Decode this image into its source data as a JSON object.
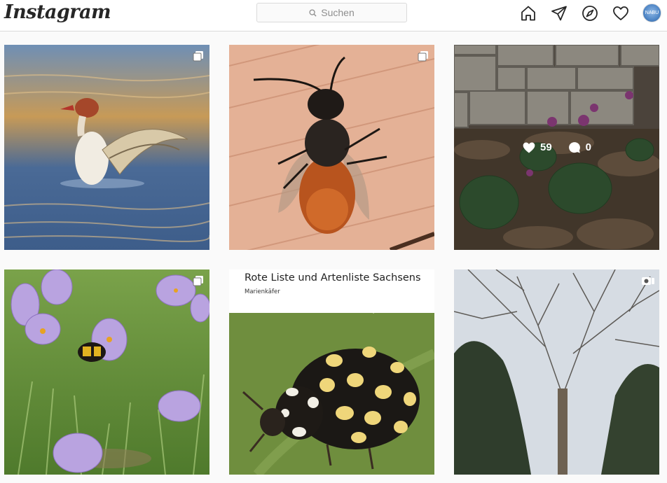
{
  "header": {
    "logo_text": "Instagram",
    "search": {
      "placeholder": "Suchen",
      "icon": "search-icon"
    },
    "nav_icons": [
      "home-icon",
      "direct-send-icon",
      "explore-compass-icon",
      "activity-heart-icon"
    ],
    "avatar_label": "NABU"
  },
  "grid": {
    "posts": [
      {
        "subject": "Merganser duck on water",
        "type": "carousel"
      },
      {
        "subject": "Mason bee on wood",
        "type": "carousel"
      },
      {
        "subject": "Cyclamen by stone wall",
        "type": "image",
        "likes": "59",
        "comments": "0"
      },
      {
        "subject": "Crocuses with bumblebee",
        "type": "carousel"
      },
      {
        "subject": "Ladybird cover",
        "type": "image",
        "cover_title": "Rote Liste und Artenliste Sachsens",
        "cover_subtitle": "Marienkäfer"
      },
      {
        "subject": "Bare trees",
        "type": "igtv"
      }
    ]
  },
  "colors": {
    "background": "#fafafa",
    "border": "#dbdbdb",
    "text": "#262626",
    "muted": "#8e8e8e"
  }
}
